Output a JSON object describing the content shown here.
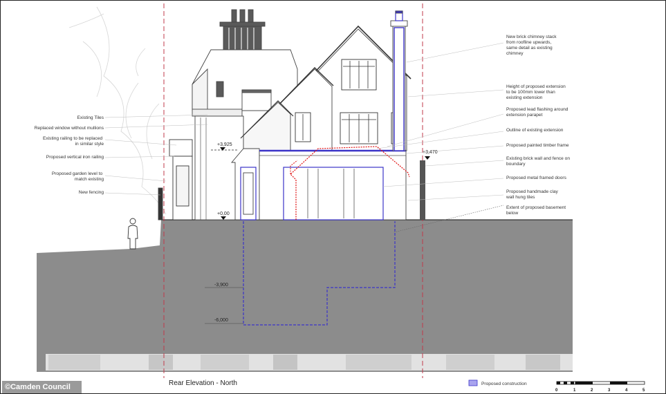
{
  "labels_left": [
    [
      "Existing Tiles"
    ],
    [
      "Replaced window without mullions"
    ],
    [
      "Existing railing to be replaced",
      "in similar style"
    ],
    [
      "Proposed vertical iron railing"
    ],
    [
      "Proposed garden level to",
      "match existing"
    ],
    [
      "New fencing"
    ]
  ],
  "labels_right": [
    [
      "New brick chimney stack",
      "from roofline upwards,",
      "same detail as existing",
      "chimney"
    ],
    [
      "Height of proposed extension",
      "to be 100mm lower than",
      "existing extension"
    ],
    [
      "Proposed lead flashing around",
      "extension parapet"
    ],
    [
      "Outline of existing extension"
    ],
    [
      "Proposed painted timber frame"
    ],
    [
      "Existing brick wall and fence on",
      "boundary"
    ],
    [
      "Proposed metal framed doors"
    ],
    [
      "Proposed handmade clay",
      "wall hung tiles"
    ],
    [
      "Extent of proposed basement",
      "below"
    ]
  ],
  "levels": {
    "upper_left": "+3,925",
    "upper_right": "+3,470",
    "ground": "+0,00",
    "basement_1": "-3,900",
    "basement_2": "-6,000"
  },
  "drawing_title": "Rear Elevation - North",
  "legend_label": "Proposed construction",
  "scale_ticks": [
    "0",
    "1",
    "2",
    "3",
    "4",
    "5"
  ],
  "logo_text": "©Camden Council",
  "colors": {
    "ground": "#8c8c8c",
    "proposed": "#3b34c8",
    "existing_outline": "#e01010",
    "boundary": "#c0394a"
  }
}
